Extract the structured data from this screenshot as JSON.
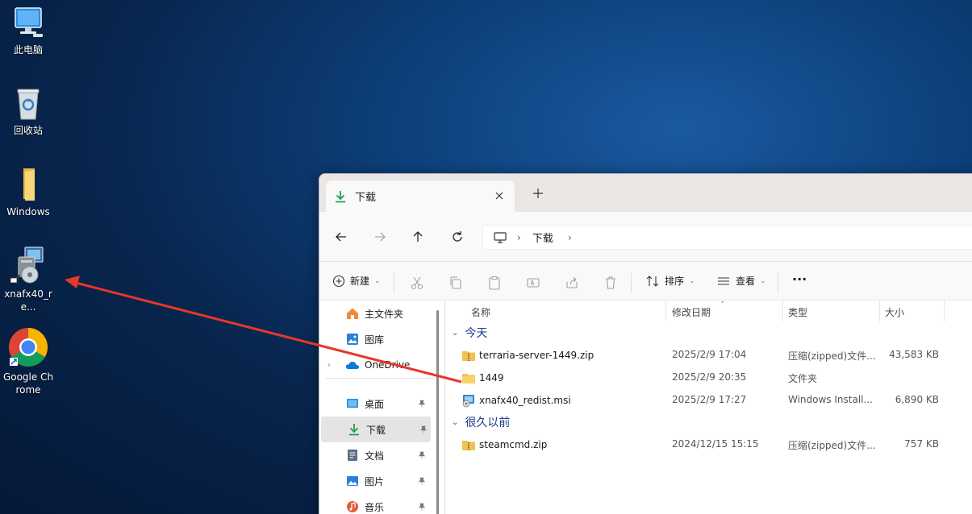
{
  "desktop": {
    "icons": [
      {
        "label": "此电脑"
      },
      {
        "label": "回收站"
      },
      {
        "label": "Windows"
      },
      {
        "label": "xnafx40_re..."
      },
      {
        "label": "Google Chrome"
      }
    ]
  },
  "explorer": {
    "tab": {
      "title": "下载"
    },
    "address": {
      "crumb": "下载"
    },
    "commands": {
      "new_label": "新建",
      "sort_label": "排序",
      "view_label": "查看",
      "more_label": "···"
    },
    "sidebar": {
      "items": [
        {
          "label": "主文件夹"
        },
        {
          "label": "图库"
        },
        {
          "label": "OneDrive"
        },
        {
          "label": "桌面"
        },
        {
          "label": "下载"
        },
        {
          "label": "文档"
        },
        {
          "label": "图片"
        },
        {
          "label": "音乐"
        }
      ]
    },
    "columns": {
      "name": "名称",
      "date": "修改日期",
      "type": "类型",
      "size": "大小"
    },
    "groups": [
      {
        "label": "今天",
        "files": [
          {
            "name": "terraria-server-1449.zip",
            "date": "2025/2/9 17:04",
            "type": "压缩(zipped)文件...",
            "size": "43,583 KB",
            "icon": "zip-folder-icon"
          },
          {
            "name": "1449",
            "date": "2025/2/9 20:35",
            "type": "文件夹",
            "size": "",
            "icon": "folder-icon"
          },
          {
            "name": "xnafx40_redist.msi",
            "date": "2025/2/9 17:27",
            "type": "Windows Install...",
            "size": "6,890 KB",
            "icon": "installer-icon"
          }
        ]
      },
      {
        "label": "很久以前",
        "files": [
          {
            "name": "steamcmd.zip",
            "date": "2024/12/15 15:15",
            "type": "压缩(zipped)文件...",
            "size": "757 KB",
            "icon": "zip-folder-icon"
          }
        ]
      }
    ]
  },
  "colors": {
    "accent": "#0067c0",
    "arrow": "#e8362a",
    "download_green": "#1f9e4e"
  }
}
